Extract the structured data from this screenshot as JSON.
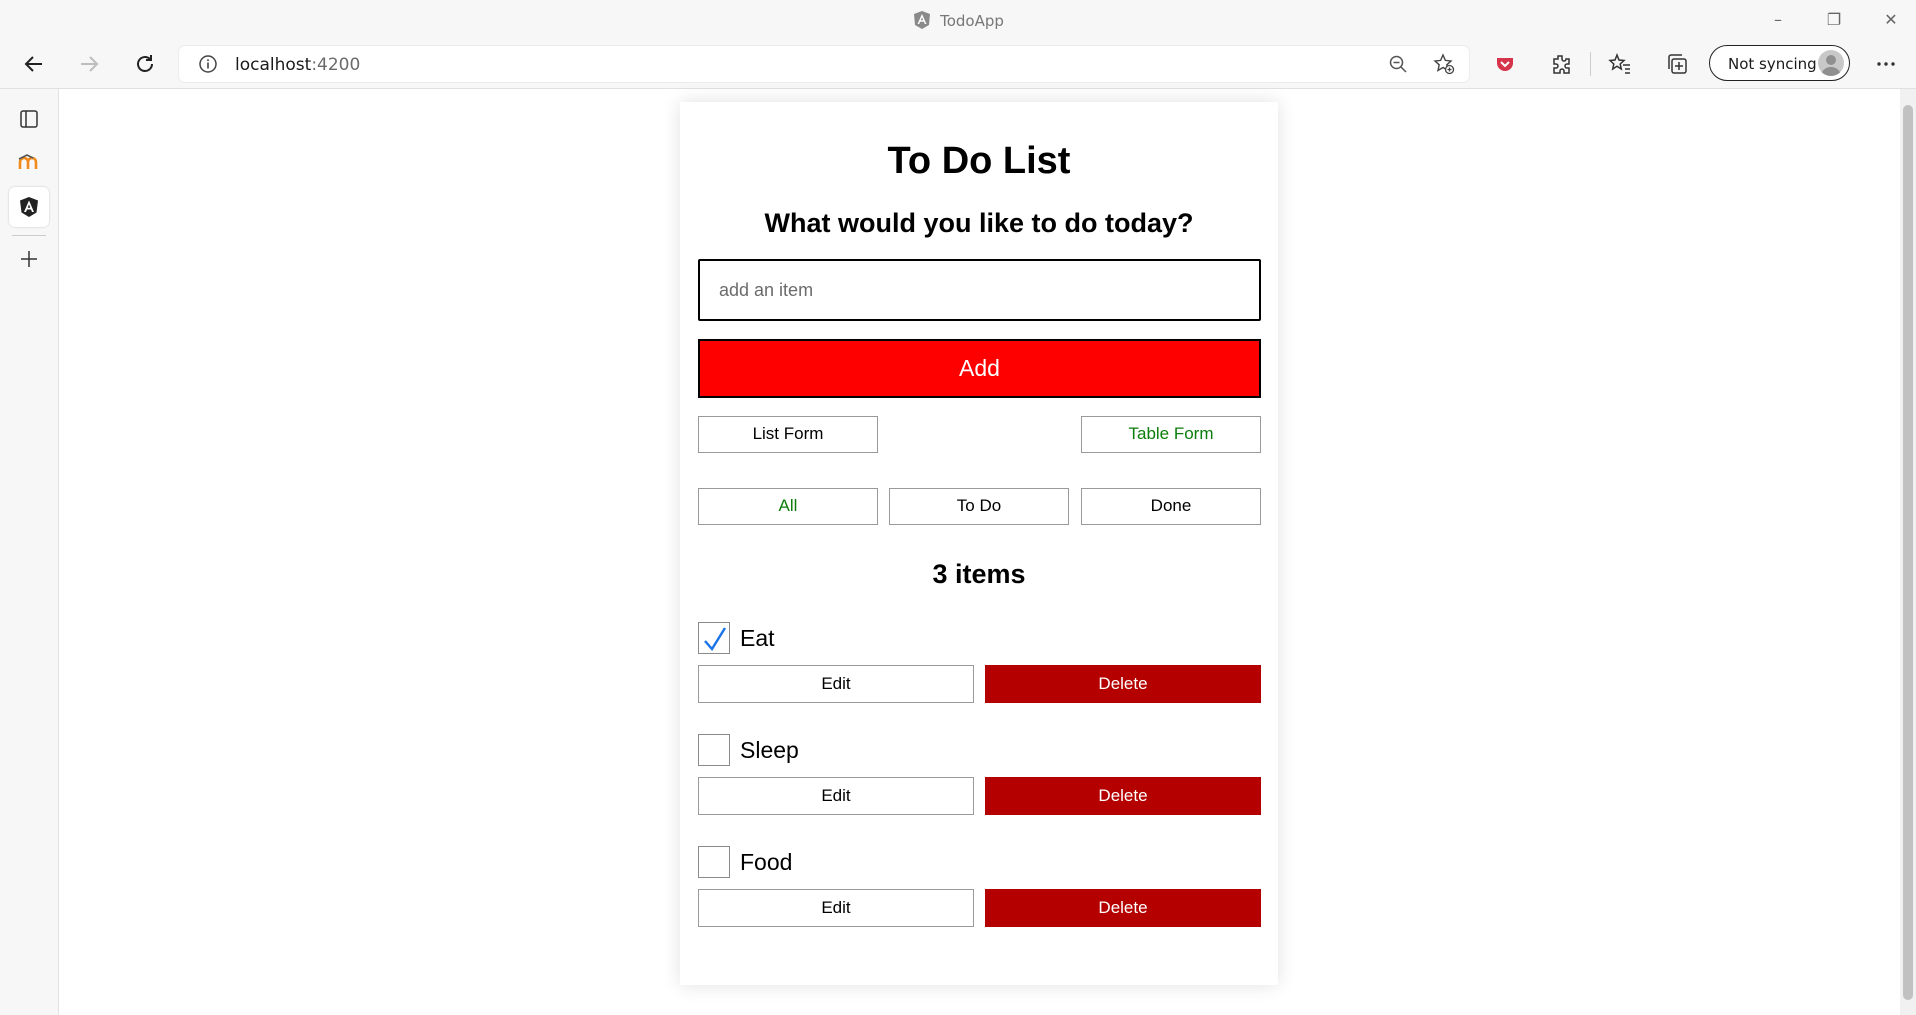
{
  "browser": {
    "window_title": "TodoApp",
    "url_host": "localhost",
    "url_port": ":4200",
    "sync_label": "Not syncing"
  },
  "app": {
    "heading": "To Do List",
    "prompt": "What would you like to do today?",
    "input_placeholder": "add an item",
    "input_value": "",
    "add_label": "Add",
    "view_buttons": {
      "list": "List Form",
      "table": "Table Form",
      "active": "table"
    },
    "filters": {
      "all": "All",
      "todo": "To Do",
      "done": "Done",
      "active": "all"
    },
    "count_label": "3 items",
    "items": [
      {
        "name": "Eat",
        "done": true,
        "edit_label": "Edit",
        "delete_label": "Delete"
      },
      {
        "name": "Sleep",
        "done": false,
        "edit_label": "Edit",
        "delete_label": "Delete"
      },
      {
        "name": "Food",
        "done": false,
        "edit_label": "Edit",
        "delete_label": "Delete"
      }
    ]
  },
  "colors": {
    "add_button": "#ff0000",
    "delete_button": "#b50000",
    "active_text": "#0a7d0a",
    "check_mark": "#1a73e8"
  }
}
